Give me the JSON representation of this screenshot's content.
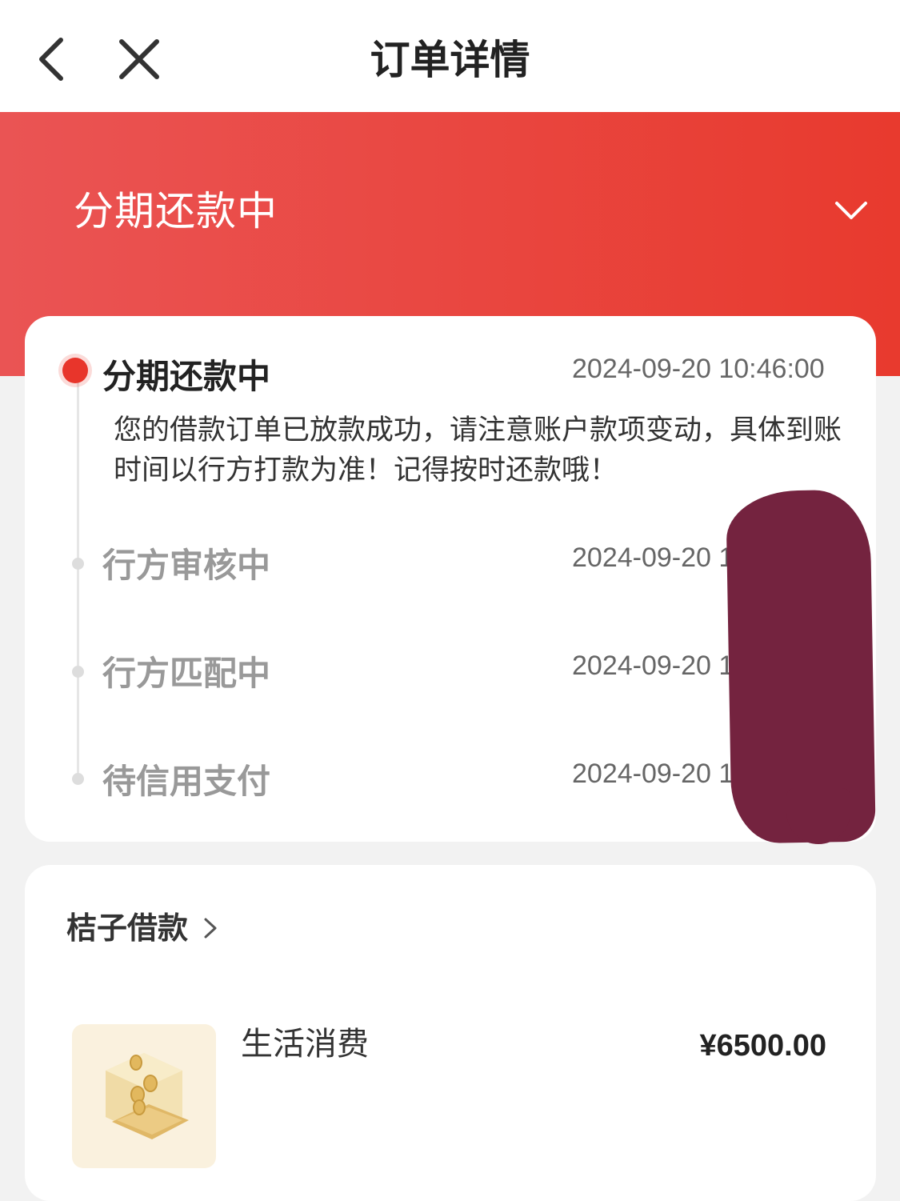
{
  "nav": {
    "title": "订单详情",
    "back_icon": "chevron-left-icon",
    "close_icon": "close-icon"
  },
  "banner": {
    "status": "分期还款中",
    "toggle_icon": "chevron-down-icon",
    "gradient": [
      "#ea5454",
      "#e83a2e"
    ]
  },
  "timeline": {
    "items": [
      {
        "title": "分期还款中",
        "time": "2024-09-20 10:46:00",
        "desc": "您的借款订单已放款成功，请注意账户款项变动，具体到账时间以行方打款为准！记得按时还款哦！",
        "active": true
      },
      {
        "title": "行方审核中",
        "time": "2024-09-20 1",
        "active": false
      },
      {
        "title": "行方匹配中",
        "time": "2024-09-20 1",
        "active": false
      },
      {
        "title": "待信用支付",
        "time": "2024-09-20 1",
        "active": false
      }
    ],
    "active_color": "#e8352b"
  },
  "product": {
    "shop_name": "桔子借款",
    "shop_chevron_icon": "chevron-right-icon",
    "thumbnail_icon": "coin-box-icon",
    "name": "生活消费",
    "price": "¥6500.00"
  }
}
